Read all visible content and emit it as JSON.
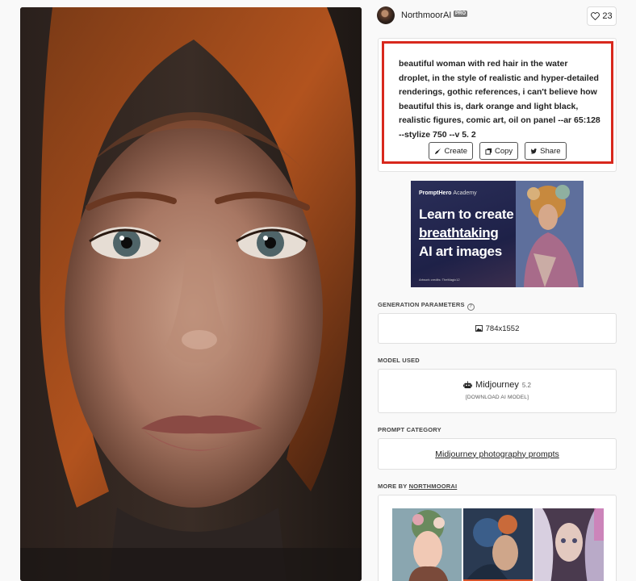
{
  "author": {
    "name": "NorthmoorAI",
    "badge": "PRO"
  },
  "likes": {
    "count": "23"
  },
  "prompt": {
    "text": "beautiful woman with red hair in the water droplet, in the style of realistic and hyper-detailed renderings, gothic references, i can't believe how beautiful this is, dark orange and light black, realistic figures, comic art, oil on panel --ar 65:128 --stylize 750 --v 5. 2",
    "create_label": "Create",
    "copy_label": "Copy",
    "share_label": "Share"
  },
  "ad": {
    "brand": "PromptHero",
    "brand_suffix": "Academy",
    "headline_1": "Learn to create",
    "headline_2": "breathtaking",
    "headline_3": "AI art images",
    "credit": "Artwork credits: TheMagic12"
  },
  "generation": {
    "label": "GENERATION PARAMETERS",
    "resolution": "784x1552"
  },
  "model": {
    "label": "MODEL USED",
    "name": "Midjourney",
    "version": "5.2",
    "download": "[DOWNLOAD AI MODEL]"
  },
  "category": {
    "label": "PROMPT CATEGORY",
    "link": "Midjourney photography prompts"
  },
  "more": {
    "label_prefix": "MORE BY",
    "label_user": "NORTHMOORAI"
  },
  "icons": {
    "like": "heart-icon",
    "create": "brush-icon",
    "copy": "copy-icon",
    "share": "twitter-icon",
    "info": "info-icon",
    "resolution": "image-icon",
    "model": "robot-icon"
  }
}
